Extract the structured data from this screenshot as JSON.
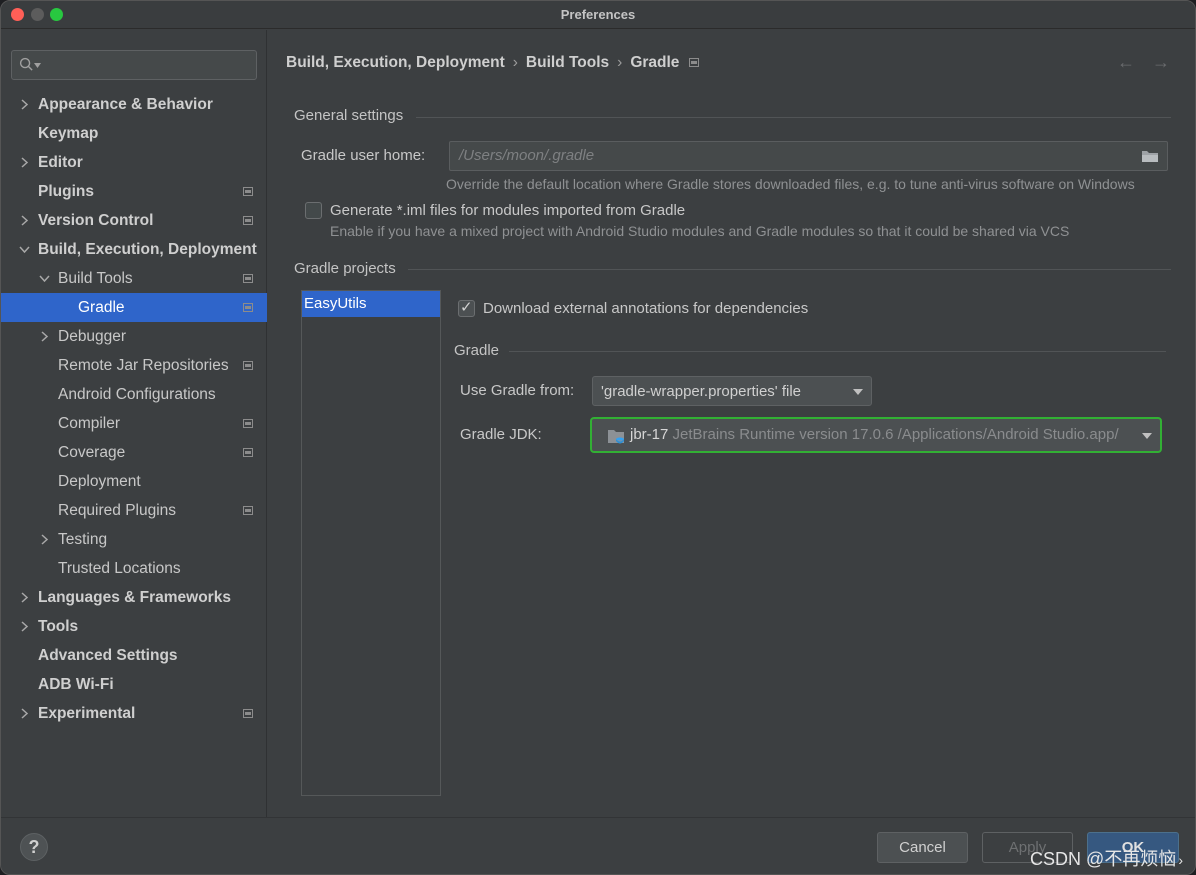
{
  "window": {
    "title": "Preferences"
  },
  "search": {
    "placeholder": ""
  },
  "sidebar": {
    "items": [
      {
        "label": "Appearance & Behavior",
        "expandable": true,
        "expanded": false
      },
      {
        "label": "Keymap",
        "expandable": false
      },
      {
        "label": "Editor",
        "expandable": true,
        "expanded": false
      },
      {
        "label": "Plugins",
        "expandable": false,
        "project_icon": true
      },
      {
        "label": "Version Control",
        "expandable": true,
        "expanded": false,
        "project_icon": true
      },
      {
        "label": "Build, Execution, Deployment",
        "expandable": true,
        "expanded": true
      },
      {
        "label": "Build Tools",
        "expandable": true,
        "expanded": true,
        "project_icon": true
      },
      {
        "label": "Gradle",
        "selected": true,
        "project_icon": true
      },
      {
        "label": "Debugger",
        "expandable": true,
        "expanded": false
      },
      {
        "label": "Remote Jar Repositories",
        "project_icon": true
      },
      {
        "label": "Android Configurations"
      },
      {
        "label": "Compiler",
        "project_icon": true
      },
      {
        "label": "Coverage",
        "project_icon": true
      },
      {
        "label": "Deployment"
      },
      {
        "label": "Required Plugins",
        "project_icon": true
      },
      {
        "label": "Testing",
        "expandable": true,
        "expanded": false
      },
      {
        "label": "Trusted Locations"
      },
      {
        "label": "Languages & Frameworks",
        "expandable": true,
        "expanded": false
      },
      {
        "label": "Tools",
        "expandable": true,
        "expanded": false
      },
      {
        "label": "Advanced Settings"
      },
      {
        "label": "ADB Wi-Fi"
      },
      {
        "label": "Experimental",
        "expandable": true,
        "expanded": false,
        "project_icon": true
      }
    ]
  },
  "breadcrumb": {
    "items": [
      "Build, Execution, Deployment",
      "Build Tools",
      "Gradle"
    ],
    "separator": "›",
    "back_icon": "arrow-left-icon",
    "forward_icon": "arrow-right-icon"
  },
  "general": {
    "title": "General settings",
    "user_home_label": "Gradle user home:",
    "user_home_value": "/Users/moon/.gradle",
    "user_home_hint": "Override the default location where Gradle stores downloaded files, e.g. to tune anti-virus software on Windows",
    "iml_label": "Generate *.iml files for modules imported from Gradle",
    "iml_checked": false,
    "iml_hint": "Enable if you have a mixed project with Android Studio modules and Gradle modules so that it could be shared via VCS"
  },
  "projects": {
    "title": "Gradle projects",
    "list": [
      "EasyUtils"
    ],
    "download_annotations_label": "Download external annotations for dependencies",
    "download_annotations_checked": true,
    "gradle_section_title": "Gradle",
    "use_gradle_from_label": "Use Gradle from:",
    "use_gradle_from_value": "'gradle-wrapper.properties' file",
    "jdk_label": "Gradle JDK:",
    "jdk_name": "jbr-17",
    "jdk_detail": "JetBrains Runtime version 17.0.6 /Applications/Android Studio.app/"
  },
  "footer": {
    "help": "?",
    "cancel": "Cancel",
    "apply": "Apply",
    "ok": "OK",
    "watermark": "CSDN @不再烦恼",
    "watermark_arrow": "›"
  },
  "colors": {
    "selection": "#2f65ca",
    "highlight_border": "#32b034",
    "background": "#3c3f41"
  }
}
